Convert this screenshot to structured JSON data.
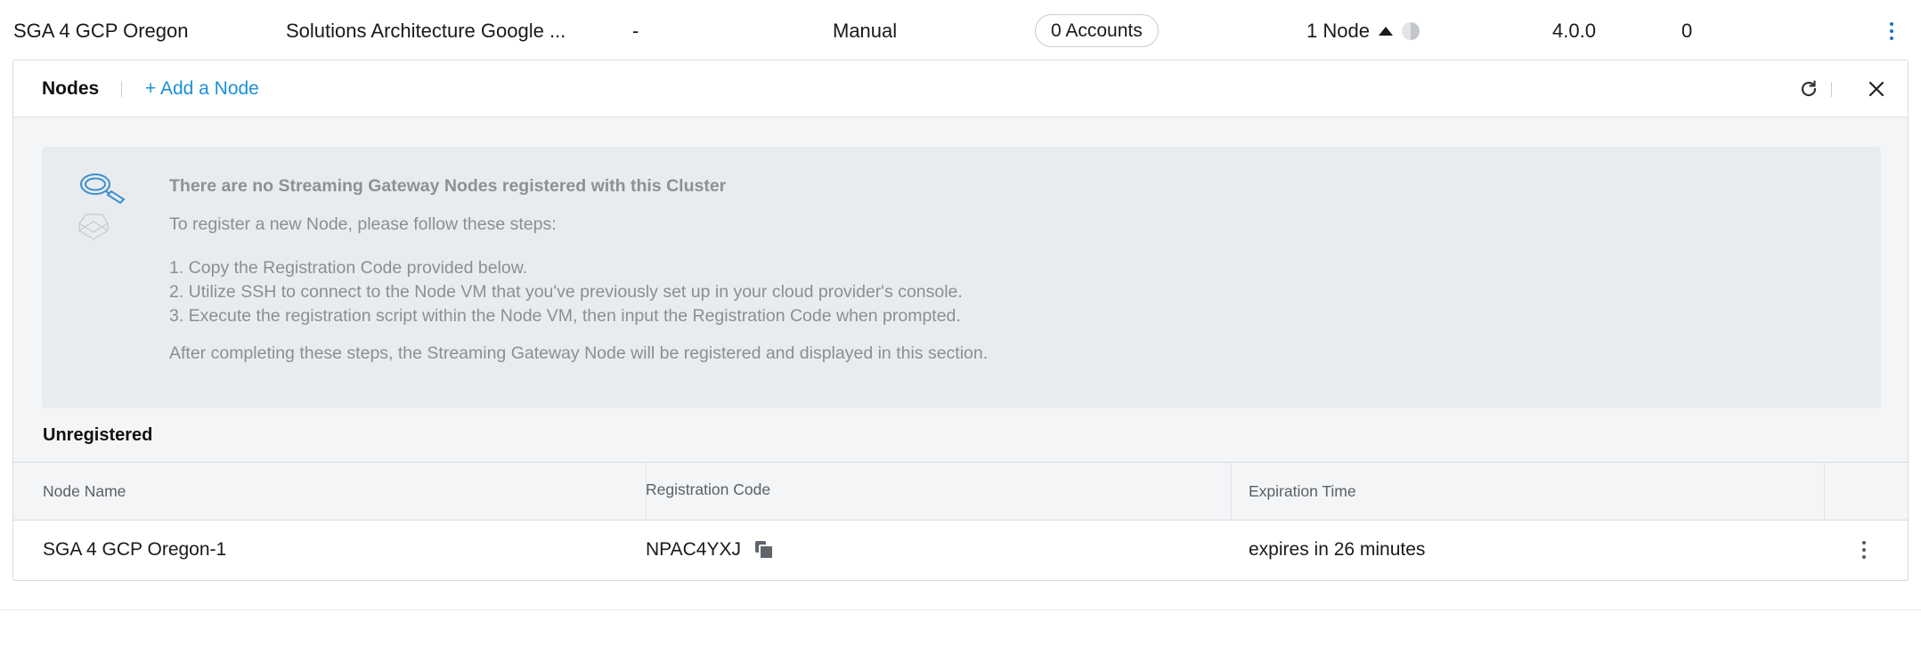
{
  "cluster_row": {
    "name": "SGA 4 GCP Oregon",
    "description": "Solutions Architecture Google ...",
    "dash": "-",
    "mode": "Manual",
    "accounts": "0 Accounts",
    "nodes": "1 Node",
    "version": "4.0.0",
    "count": "0"
  },
  "panel": {
    "tab_label": "Nodes",
    "add_node_label": "+ Add a Node"
  },
  "empty_state": {
    "heading": "There are no Streaming Gateway Nodes registered with this Cluster",
    "lead": "To register a new Node, please follow these steps:",
    "steps": [
      "1. Copy the Registration Code provided below.",
      "2. Utilize SSH to connect to the Node VM that you've previously set up in your cloud provider's console.",
      "3. Execute the registration script within the Node VM, then input the Registration Code when prompted."
    ],
    "after": "After completing these steps, the Streaming Gateway Node will be registered and displayed in this section."
  },
  "unregistered": {
    "title": "Unregistered",
    "columns": [
      "Node Name",
      "Registration Code",
      "Expiration Time"
    ],
    "rows": [
      {
        "node_name": "SGA 4 GCP Oregon-1",
        "registration_code": "NPAC4YXJ",
        "expiration": "expires in 26 minutes"
      }
    ]
  },
  "colors": {
    "accent_link": "#1c8fd9",
    "empty_box_bg": "#e9ecef",
    "panel_bg": "#f4f5f6"
  },
  "icons": [
    "chevron-up-icon",
    "status-pie-icon",
    "more-vertical-icon",
    "refresh-icon",
    "close-icon",
    "magnifier-illustration",
    "copy-icon"
  ]
}
